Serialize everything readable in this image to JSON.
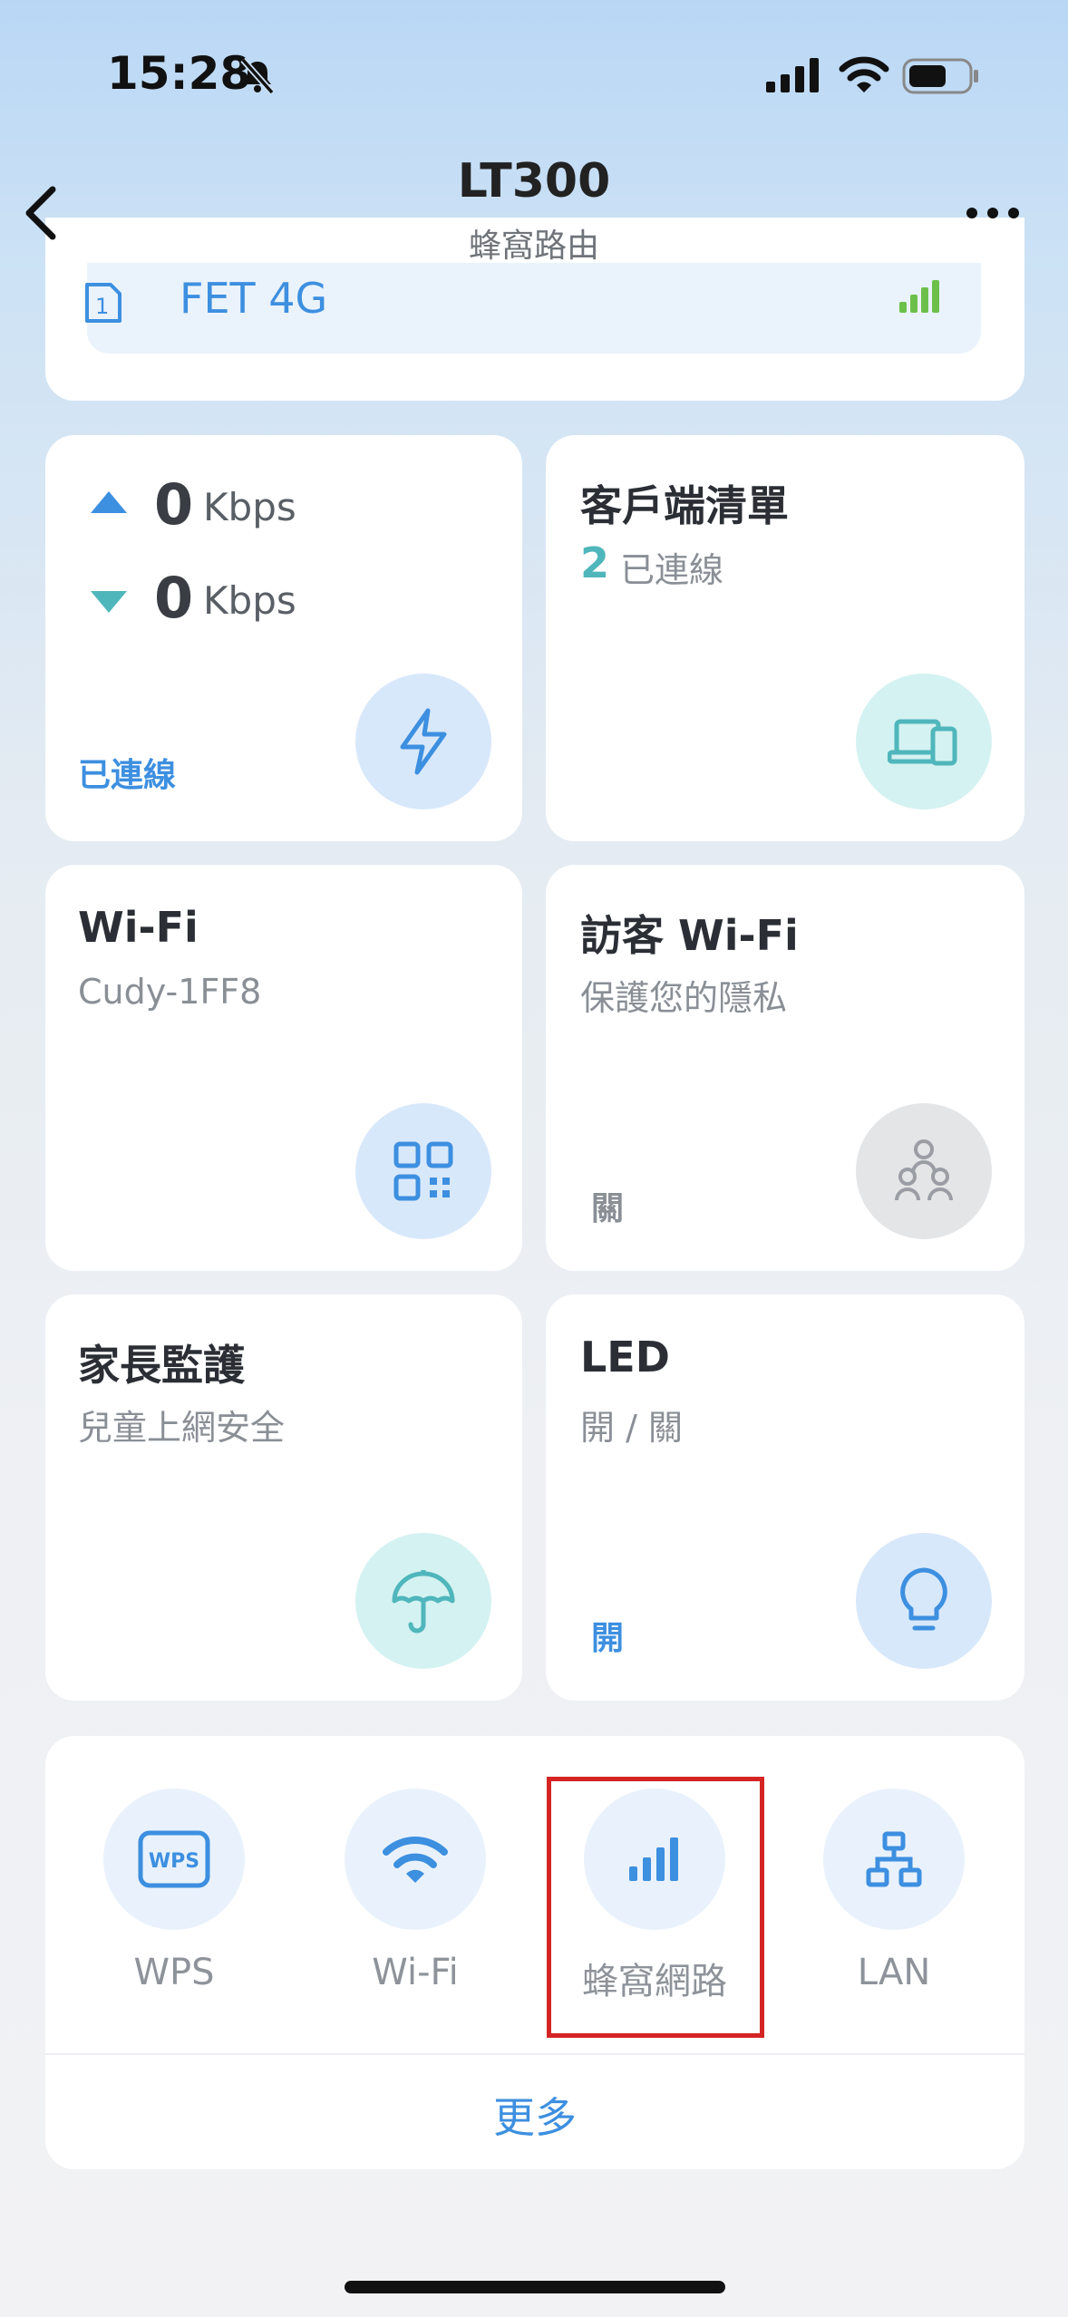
{
  "status": {
    "time": "15:28"
  },
  "header": {
    "title": "LT300",
    "subtitle": "蜂窩路由"
  },
  "sim": {
    "label": "FET 4G",
    "slot": "1"
  },
  "traffic": {
    "up_value": "0",
    "up_unit": "Kbps",
    "down_value": "0",
    "down_unit": "Kbps",
    "status": "已連線"
  },
  "clients": {
    "title": "客戶端清單",
    "count": "2",
    "count_label": "已連線"
  },
  "wifi_tile": {
    "title": "Wi-Fi",
    "ssid": "Cudy-1FF8"
  },
  "guest_wifi": {
    "title": "訪客 Wi-Fi",
    "subtitle": "保護您的隱私",
    "status": "關"
  },
  "parental": {
    "title": "家長監護",
    "subtitle": "兒童上網安全"
  },
  "led": {
    "title": "LED",
    "subtitle": "開 / 關",
    "status": "開"
  },
  "quick_actions": [
    {
      "label": "WPS",
      "icon": "wps-icon"
    },
    {
      "label": "Wi-Fi",
      "icon": "wifi-icon"
    },
    {
      "label": "蜂窩網路",
      "icon": "cellular-icon"
    },
    {
      "label": "LAN",
      "icon": "lan-icon"
    }
  ],
  "more": "更多",
  "colors": {
    "accent": "#3d8fe0",
    "teal": "#4fb6bc",
    "highlight": "#d42424"
  }
}
